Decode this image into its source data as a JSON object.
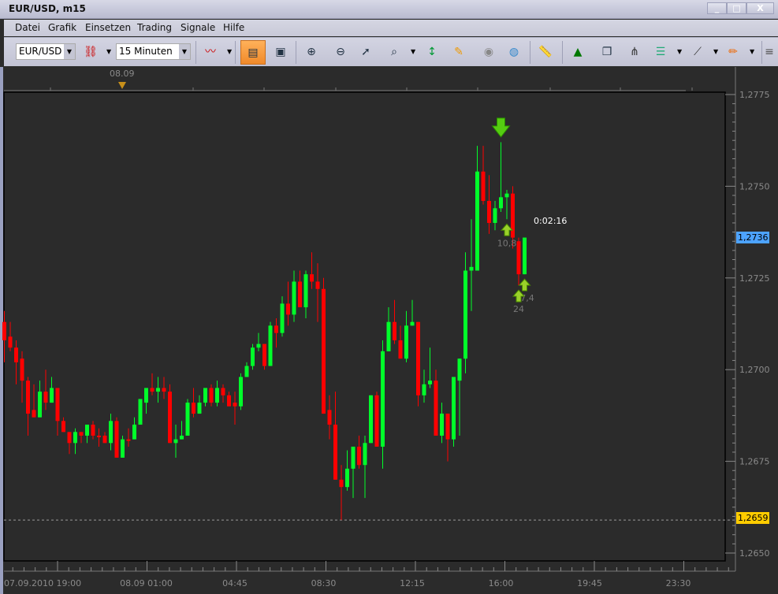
{
  "window": {
    "title": "EUR/USD, m15",
    "minimize": "_",
    "maximize": "□",
    "close": "X"
  },
  "menu": [
    "Datei",
    "Grafik",
    "Einsetzen",
    "Trading",
    "Signale",
    "Hilfe"
  ],
  "toolbar": {
    "symbol": "EUR/USD",
    "timeframe": "15 Minuten",
    "icons": [
      "unlink-icon",
      "chart-type-icon",
      "bar-chart-icon",
      "text-chart-icon",
      "zoom-in-icon",
      "zoom-out-icon",
      "zoom-cursor-icon",
      "zoom-fit-icon",
      "vertical-scale-icon",
      "properties-icon",
      "eye-icon",
      "globe-icon",
      "ruler-icon",
      "add-image-icon",
      "window-chart-icon",
      "pitchfork-icon",
      "indicator-list-icon",
      "fan-icon",
      "pencil-icon",
      "overflow-menu-icon"
    ]
  },
  "colors": {
    "background": "#2b2b2b",
    "bull": "#00ff2a",
    "bear": "#ff0000",
    "current_price": "#4da3ff",
    "low_price": "#ffcc00",
    "signal": "#55cc11"
  },
  "chart_data": {
    "type": "candlestick",
    "timeframe": "m15",
    "top_marker": "08.09",
    "x_tick_labels": [
      "07.09.2010 19:00",
      "08.09 01:00",
      "04:45",
      "08:30",
      "12:15",
      "16:00",
      "19:45",
      "23:30"
    ],
    "y_tick_labels": [
      "1,2775",
      "1,2750",
      "1,2725",
      "1,2700",
      "1,2675",
      "1,2650"
    ],
    "y_ticks": [
      1.2775,
      1.275,
      1.2725,
      1.27,
      1.2675,
      1.265
    ],
    "ylim": [
      1.265,
      1.2775
    ],
    "grid": false,
    "current_price": {
      "value": 1.2736,
      "label": "1,2736"
    },
    "low_line": {
      "value": 1.2659,
      "label": "1,2659"
    },
    "countdown": "0:02:16",
    "candles_ohlc": [
      [
        1.2713,
        1.2716,
        1.2702,
        1.2708
      ],
      [
        1.2709,
        1.2713,
        1.2705,
        1.2706
      ],
      [
        1.2706,
        1.2708,
        1.2696,
        1.2702
      ],
      [
        1.2703,
        1.2705,
        1.2691,
        1.2697
      ],
      [
        1.2697,
        1.2698,
        1.2682,
        1.2688
      ],
      [
        1.2689,
        1.2696,
        1.2687,
        1.2687
      ],
      [
        1.2687,
        1.2697,
        1.2687,
        1.2694
      ],
      [
        1.2694,
        1.27,
        1.2689,
        1.2691
      ],
      [
        1.2691,
        1.2698,
        1.2691,
        1.2695
      ],
      [
        1.2695,
        1.2695,
        1.2682,
        1.2686
      ],
      [
        1.2686,
        1.2687,
        1.2683,
        1.2683
      ],
      [
        1.2683,
        1.2683,
        1.2677,
        1.268
      ],
      [
        1.268,
        1.2684,
        1.2677,
        1.2683
      ],
      [
        1.2683,
        1.2683,
        1.268,
        1.2682
      ],
      [
        1.2682,
        1.2685,
        1.268,
        1.2685
      ],
      [
        1.2685,
        1.2686,
        1.2681,
        1.2682
      ],
      [
        1.2682,
        1.2684,
        1.2679,
        1.2682
      ],
      [
        1.2682,
        1.2683,
        1.268,
        1.268
      ],
      [
        1.268,
        1.2688,
        1.2678,
        1.2686
      ],
      [
        1.2686,
        1.2687,
        1.2676,
        1.2676
      ],
      [
        1.2676,
        1.2682,
        1.2676,
        1.2681
      ],
      [
        1.2681,
        1.2684,
        1.2679,
        1.2681
      ],
      [
        1.2681,
        1.2687,
        1.2681,
        1.2685
      ],
      [
        1.2685,
        1.2692,
        1.2685,
        1.2692
      ],
      [
        1.2691,
        1.2695,
        1.2688,
        1.2695
      ],
      [
        1.2695,
        1.2699,
        1.2693,
        1.2694
      ],
      [
        1.2694,
        1.2698,
        1.2691,
        1.2695
      ],
      [
        1.2695,
        1.2698,
        1.2692,
        1.2694
      ],
      [
        1.2694,
        1.2696,
        1.268,
        1.268
      ],
      [
        1.268,
        1.2685,
        1.2676,
        1.2681
      ],
      [
        1.2681,
        1.2686,
        1.2681,
        1.2682
      ],
      [
        1.2682,
        1.2692,
        1.2682,
        1.2691
      ],
      [
        1.2691,
        1.2695,
        1.2687,
        1.2688
      ],
      [
        1.2688,
        1.2693,
        1.2688,
        1.2691
      ],
      [
        1.2691,
        1.2695,
        1.269,
        1.2695
      ],
      [
        1.2695,
        1.2696,
        1.269,
        1.2691
      ],
      [
        1.2691,
        1.2697,
        1.269,
        1.2695
      ],
      [
        1.2695,
        1.2696,
        1.2691,
        1.2693
      ],
      [
        1.2693,
        1.2694,
        1.269,
        1.269
      ],
      [
        1.2691,
        1.2694,
        1.2685,
        1.269
      ],
      [
        1.269,
        1.2699,
        1.2689,
        1.2698
      ],
      [
        1.2698,
        1.2702,
        1.2698,
        1.2701
      ],
      [
        1.2701,
        1.2707,
        1.27,
        1.2706
      ],
      [
        1.2706,
        1.271,
        1.2705,
        1.2707
      ],
      [
        1.2707,
        1.2707,
        1.27,
        1.2701
      ],
      [
        1.2701,
        1.2713,
        1.2701,
        1.2712
      ],
      [
        1.2712,
        1.2714,
        1.2706,
        1.271
      ],
      [
        1.271,
        1.272,
        1.2709,
        1.2718
      ],
      [
        1.2718,
        1.2724,
        1.2712,
        1.2715
      ],
      [
        1.2715,
        1.2727,
        1.2713,
        1.2724
      ],
      [
        1.2724,
        1.2727,
        1.2717,
        1.2717
      ],
      [
        1.2717,
        1.2727,
        1.2714,
        1.2726
      ],
      [
        1.2726,
        1.2732,
        1.2722,
        1.2724
      ],
      [
        1.2724,
        1.2729,
        1.2713,
        1.2722
      ],
      [
        1.2722,
        1.2725,
        1.2688,
        1.2688
      ],
      [
        1.2689,
        1.2693,
        1.2681,
        1.2685
      ],
      [
        1.2685,
        1.2694,
        1.267,
        1.267
      ],
      [
        1.267,
        1.2674,
        1.2659,
        1.2668
      ],
      [
        1.2668,
        1.2678,
        1.2667,
        1.2673
      ],
      [
        1.2673,
        1.2679,
        1.2665,
        1.2679
      ],
      [
        1.2679,
        1.2682,
        1.2673,
        1.2674
      ],
      [
        1.2674,
        1.2682,
        1.2665,
        1.268
      ],
      [
        1.268,
        1.2693,
        1.268,
        1.2693
      ],
      [
        1.2693,
        1.2694,
        1.2679,
        1.2679
      ],
      [
        1.2679,
        1.2708,
        1.2673,
        1.2705
      ],
      [
        1.2705,
        1.2717,
        1.2705,
        1.2713
      ],
      [
        1.2713,
        1.2719,
        1.2707,
        1.2708
      ],
      [
        1.2708,
        1.2712,
        1.2703,
        1.2703
      ],
      [
        1.2703,
        1.2716,
        1.2702,
        1.2712
      ],
      [
        1.2712,
        1.2719,
        1.2712,
        1.2713
      ],
      [
        1.2713,
        1.2713,
        1.269,
        1.2693
      ],
      [
        1.2693,
        1.27,
        1.2691,
        1.2696
      ],
      [
        1.2696,
        1.2706,
        1.2695,
        1.2697
      ],
      [
        1.2697,
        1.27,
        1.2682,
        1.2682
      ],
      [
        1.2682,
        1.2691,
        1.268,
        1.2688
      ],
      [
        1.2688,
        1.2688,
        1.2675,
        1.2681
      ],
      [
        1.2681,
        1.2698,
        1.2679,
        1.2698
      ],
      [
        1.2697,
        1.2703,
        1.2682,
        1.2703
      ],
      [
        1.2703,
        1.2732,
        1.2699,
        1.2727
      ],
      [
        1.2727,
        1.2741,
        1.2716,
        1.2728
      ],
      [
        1.2727,
        1.2761,
        1.2727,
        1.2754
      ],
      [
        1.2754,
        1.2761,
        1.2745,
        1.2746
      ],
      [
        1.2746,
        1.2753,
        1.2737,
        1.274
      ],
      [
        1.274,
        1.2746,
        1.2738,
        1.2744
      ],
      [
        1.2744,
        1.2762,
        1.2743,
        1.2747
      ],
      [
        1.2747,
        1.2749,
        1.2741,
        1.2748
      ],
      [
        1.2748,
        1.275,
        1.2733,
        1.2736
      ],
      [
        1.2735,
        1.2736,
        1.2723,
        1.2726
      ],
      [
        1.2726,
        1.2736,
        1.2726,
        1.2736
      ]
    ],
    "signals": [
      {
        "type": "sell",
        "candle": 84,
        "price": 1.2766,
        "label": ""
      },
      {
        "type": "buy",
        "candle": 85,
        "price": 1.2738,
        "label": "10,8"
      },
      {
        "type": "buy",
        "candle": 88,
        "price": 1.2723,
        "label": "17,4"
      },
      {
        "type": "buy",
        "candle": 87,
        "price": 1.272,
        "label": "24"
      }
    ]
  }
}
